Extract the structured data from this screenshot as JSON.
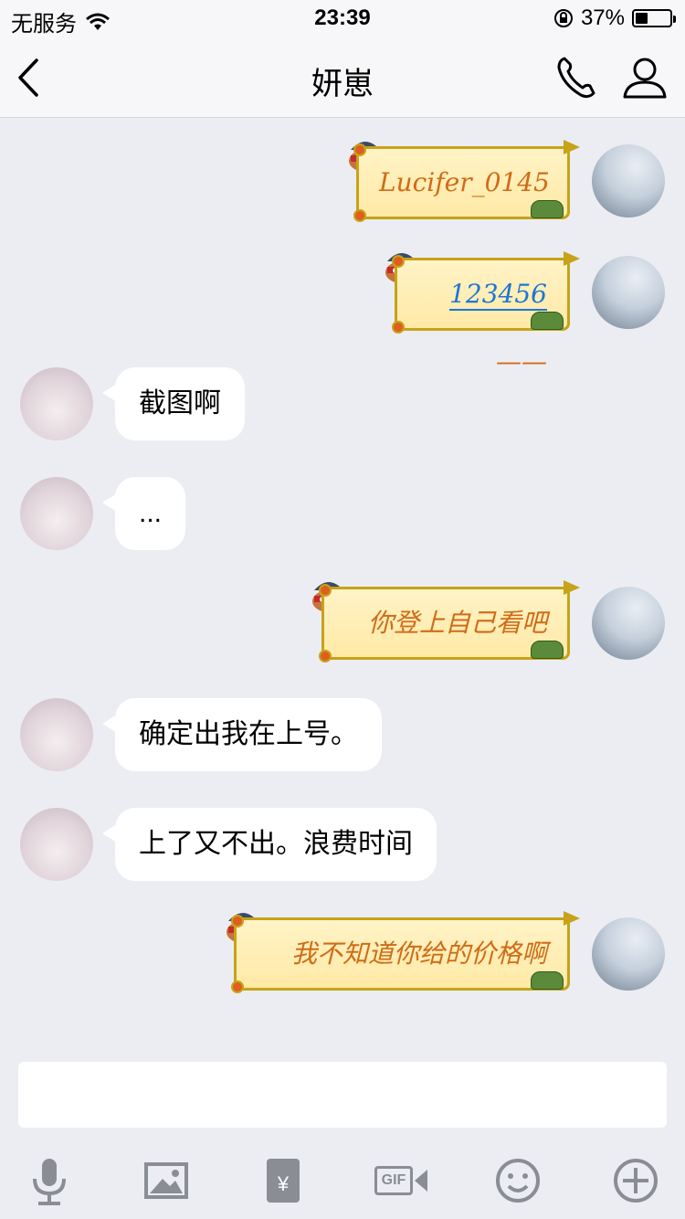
{
  "status_bar": {
    "carrier": "无服务",
    "time": "23:39",
    "battery": "37%",
    "battery_fraction": 0.37
  },
  "nav": {
    "title": "妍崽"
  },
  "messages": [
    {
      "side": "right",
      "style": "scroll",
      "text": "Lucifer_0145"
    },
    {
      "side": "right",
      "style": "scroll",
      "text": "123456",
      "suffix": "——"
    },
    {
      "side": "left",
      "style": "plain",
      "text": "截图啊"
    },
    {
      "side": "left",
      "style": "plain",
      "text": "..."
    },
    {
      "side": "right",
      "style": "scroll",
      "text": "你登上自己看吧"
    },
    {
      "side": "left",
      "style": "plain",
      "text": "确定出我在上号。"
    },
    {
      "side": "left",
      "style": "plain",
      "text": "上了又不出。浪费时间"
    },
    {
      "side": "right",
      "style": "scroll",
      "text": "我不知道你给的价格啊"
    }
  ],
  "input": {
    "value": ""
  },
  "toolbar": {
    "gif_label": "GIF",
    "redpacket_symbol": "¥"
  },
  "icons": [
    "wifi-icon",
    "lock-rotation-icon",
    "back-icon",
    "phone-icon",
    "profile-icon",
    "microphone-icon",
    "image-icon",
    "red-packet-icon",
    "gif-icon",
    "emoji-icon",
    "plus-icon"
  ]
}
